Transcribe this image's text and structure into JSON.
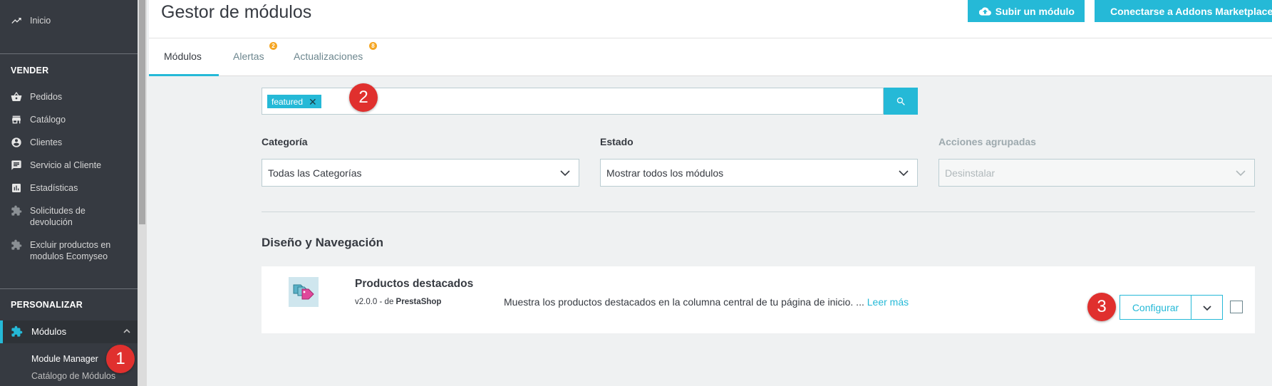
{
  "sidebar": {
    "top_items": [
      {
        "label": "Inicio",
        "icon": "trending-up-icon"
      }
    ],
    "sections": [
      {
        "title": "VENDER"
      },
      {
        "title": "PERSONALIZAR"
      }
    ],
    "vender_items": [
      {
        "label": "Pedidos",
        "icon": "basket-icon"
      },
      {
        "label": "Catálogo",
        "icon": "store-icon"
      },
      {
        "label": "Clientes",
        "icon": "account-circle-icon"
      },
      {
        "label": "Servicio al Cliente",
        "icon": "chat-icon"
      },
      {
        "label": "Estadísticas",
        "icon": "bar-chart-icon"
      },
      {
        "label_line1": "Solicitudes de",
        "label_line2": "devolución",
        "icon": "puzzle-icon"
      },
      {
        "label_line1": "Excluir productos en",
        "label_line2": "modulos Ecomyseo",
        "icon": "puzzle-icon"
      }
    ],
    "active_group": {
      "label": "Módulos",
      "icon": "puzzle-icon"
    },
    "sub_items": [
      {
        "label": "Module Manager",
        "active": true
      },
      {
        "label": "Catálogo de Módulos",
        "active": false
      }
    ]
  },
  "header": {
    "title": "Gestor de módulos",
    "buttons": [
      {
        "label": "Subir un módulo",
        "icon": "cloud-upload-icon"
      },
      {
        "label": "Conectarse a Addons Marketplace",
        "icon": "key-icon"
      }
    ]
  },
  "tabs": [
    {
      "label": "Módulos",
      "active": true,
      "badge": ""
    },
    {
      "label": "Alertas",
      "active": false,
      "badge": "2"
    },
    {
      "label": "Actualizaciones",
      "active": false,
      "badge": "8"
    }
  ],
  "search": {
    "chip": "featured"
  },
  "filters": [
    {
      "label": "Categoría",
      "value": "Todas las Categorías",
      "disabled": false
    },
    {
      "label": "Estado",
      "value": "Mostrar todos los módulos",
      "disabled": false
    },
    {
      "label": "Acciones agrupadas",
      "value": "Desinstalar",
      "disabled": true
    }
  ],
  "section_heading": "Diseño y Navegación",
  "module": {
    "name": "Productos destacados",
    "version": "v2.0.0 - de",
    "author": "PrestaShop",
    "description": "Muestra los productos destacados en la columna central de tu página de inicio. ...",
    "read_more": "Leer más",
    "configure_label": "Configurar"
  },
  "markers": [
    "1",
    "2",
    "3"
  ],
  "colors": {
    "accent": "#25b9d7",
    "sidebar_bg": "#363a41",
    "marker": "#e0302e",
    "badge": "#f5a623"
  }
}
